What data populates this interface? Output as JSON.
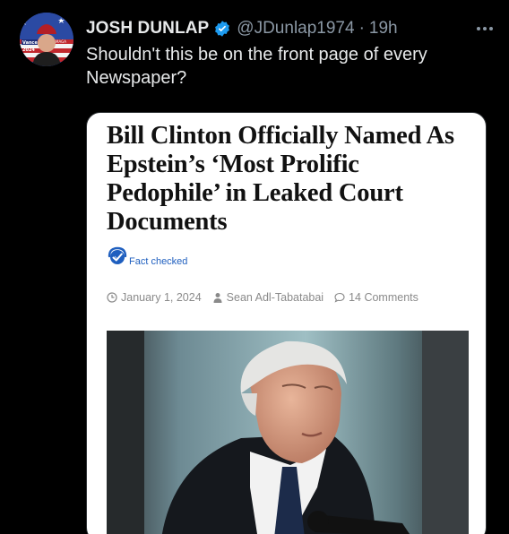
{
  "tweet": {
    "display_name": "JOSH DUNLAP",
    "handle": "@JDunlap1974",
    "separator": "·",
    "time": "19h",
    "text": "Shouldn't this be on the front page of every Newspaper?",
    "avatar_text": [
      "Vance",
      "MAGA",
      "2024"
    ]
  },
  "article": {
    "headline": "Bill Clinton Officially Named As Epstein’s ‘Most Prolific Pedophile’ in Leaked Court Documents",
    "fact_check_label": "Fact checked",
    "date": "January 1, 2024",
    "author": "Sean Adl-Tabatabai",
    "comments": "14 Comments"
  },
  "colors": {
    "background": "#000000",
    "verified": "#1d9bf0",
    "secondary_text": "#8b98a5",
    "fact_check": "#1f5fbf"
  }
}
